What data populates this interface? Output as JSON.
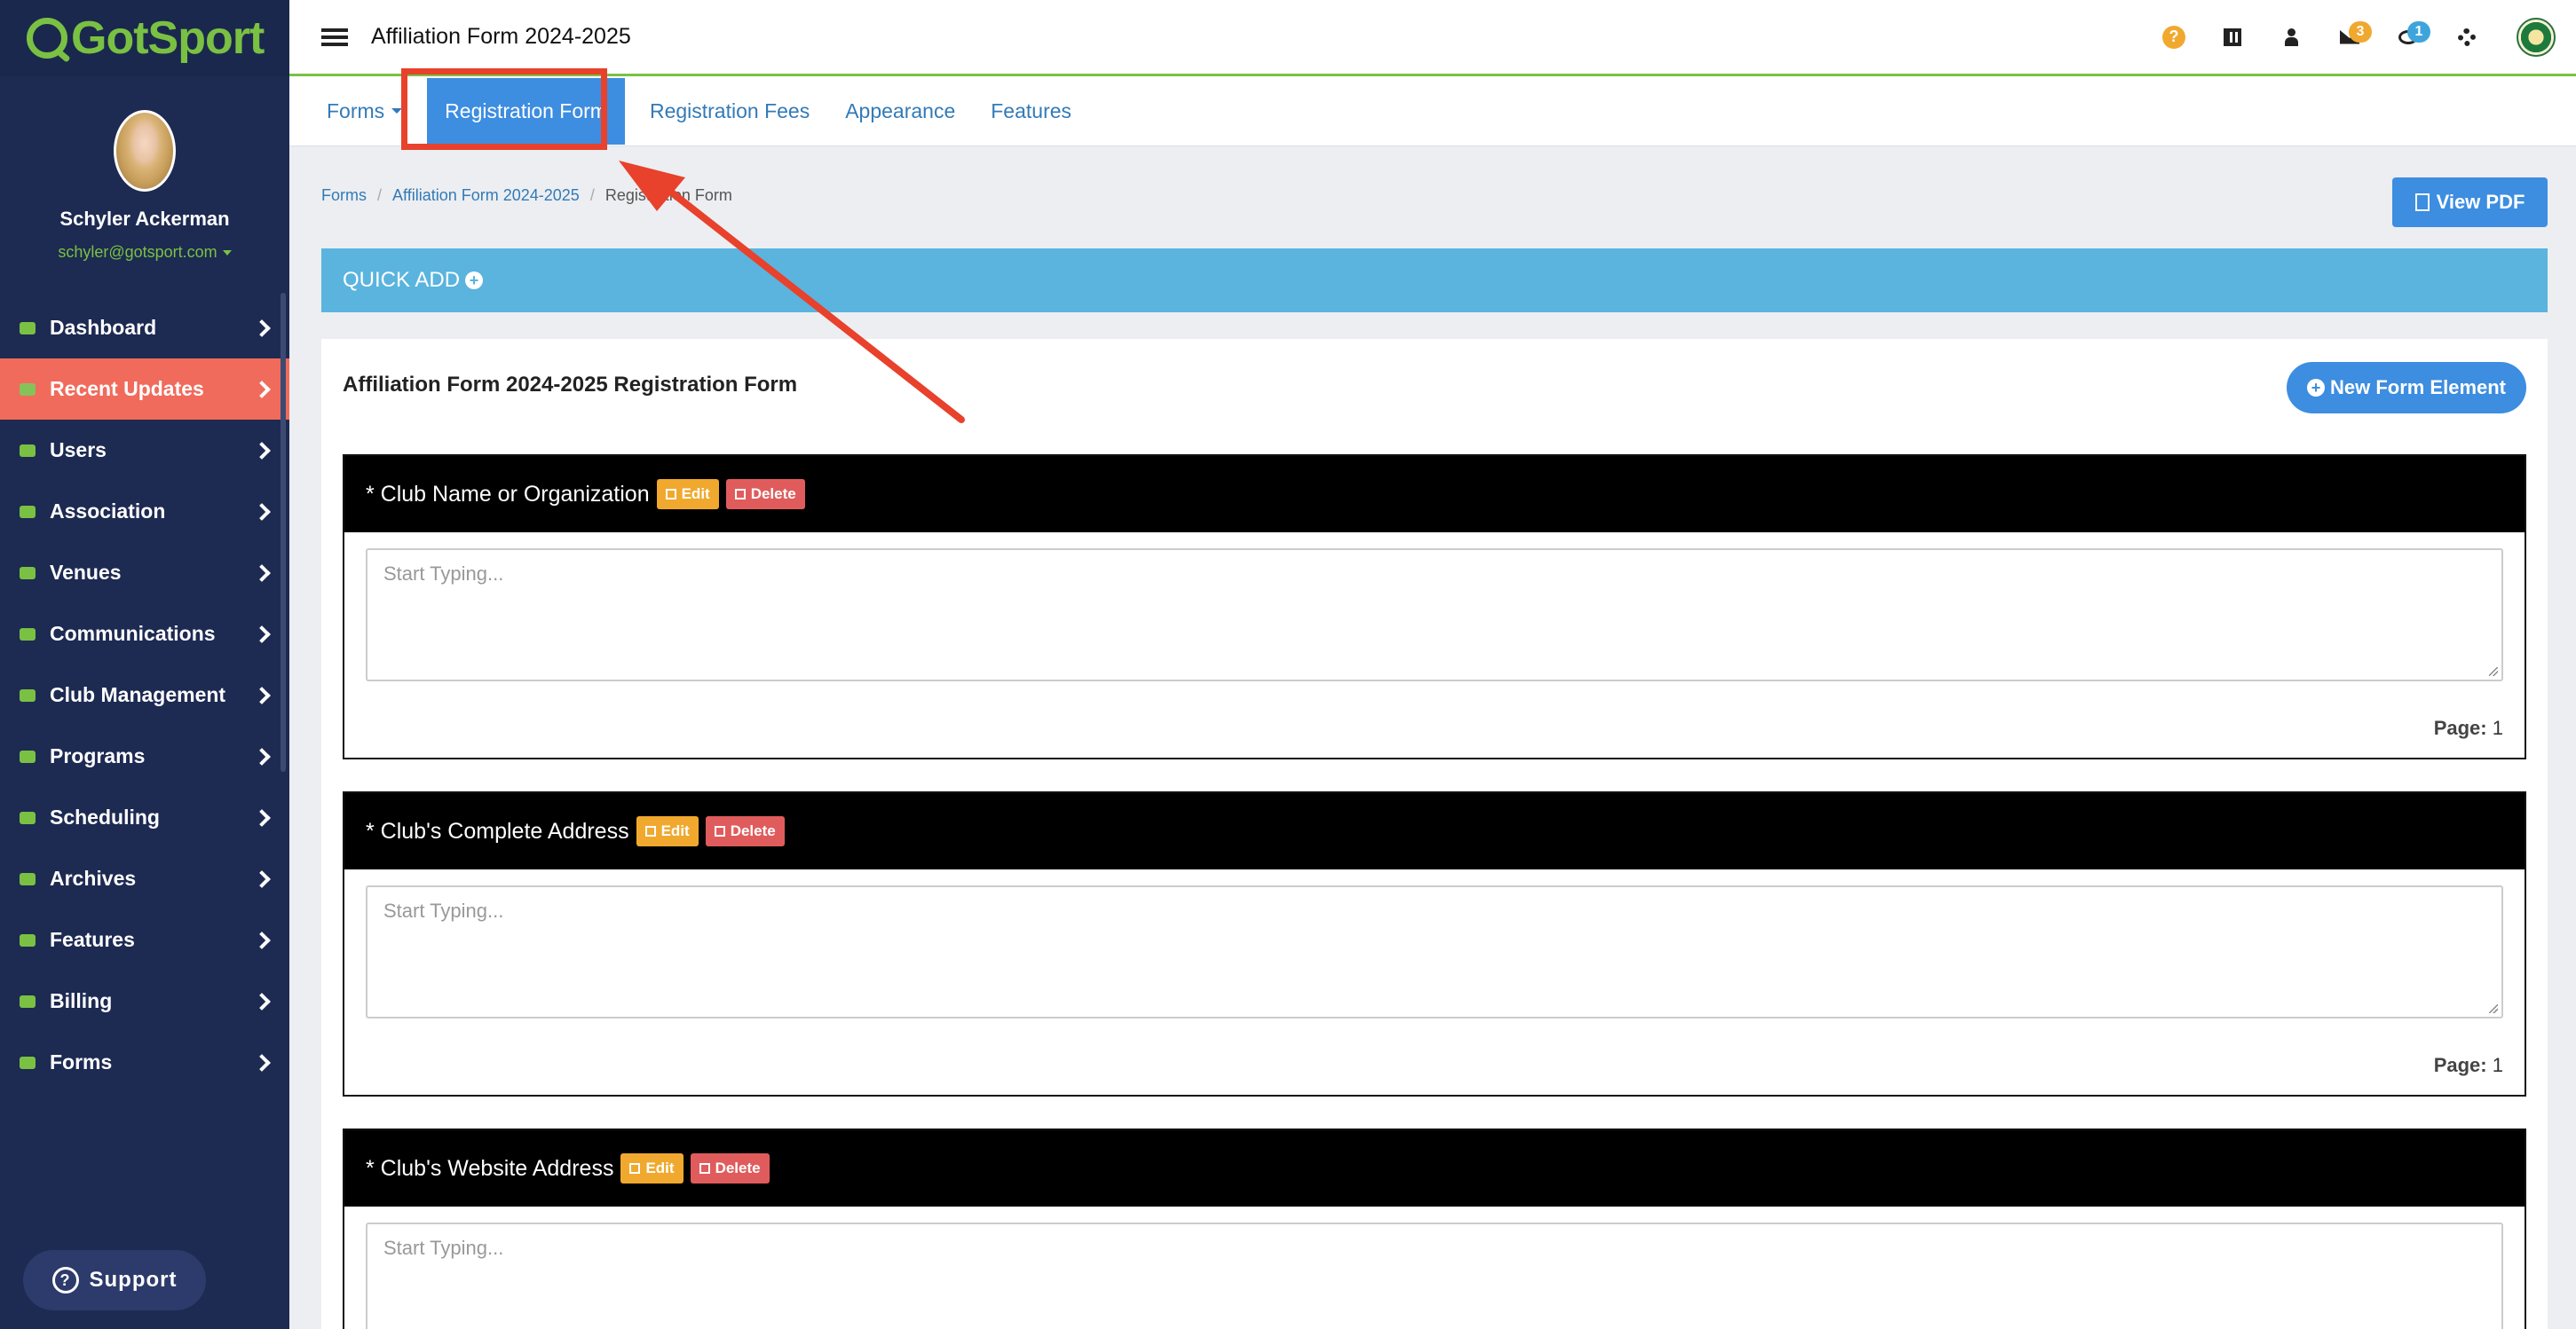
{
  "brand": {
    "name": "GotSport"
  },
  "profile": {
    "name": "Schyler Ackerman",
    "email": "schyler@gotsport.com"
  },
  "sidebar": {
    "items": [
      {
        "label": "Dashboard",
        "icon": "dashboard-icon"
      },
      {
        "label": "Recent Updates",
        "icon": "calendar-icon",
        "active": true
      },
      {
        "label": "Users",
        "icon": "users-icon"
      },
      {
        "label": "Association",
        "icon": "sitemap-icon"
      },
      {
        "label": "Venues",
        "icon": "home-icon"
      },
      {
        "label": "Communications",
        "icon": "chat-icon"
      },
      {
        "label": "Club Management",
        "icon": "list-icon"
      },
      {
        "label": "Programs",
        "icon": "document-icon"
      },
      {
        "label": "Scheduling",
        "icon": "table-icon"
      },
      {
        "label": "Archives",
        "icon": "archive-icon"
      },
      {
        "label": "Features",
        "icon": "star-icon"
      },
      {
        "label": "Billing",
        "icon": "credit-card-icon"
      },
      {
        "label": "Forms",
        "icon": "file-icon"
      }
    ],
    "support_label": "Support"
  },
  "topbar": {
    "title": "Affiliation Form 2024-2025",
    "mail_count": "3",
    "chat_count": "1"
  },
  "tabs": {
    "forms": "Forms",
    "registration_form": "Registration Form",
    "registration_fees": "Registration Fees",
    "appearance": "Appearance",
    "features": "Features"
  },
  "breadcrumb": {
    "item1": "Forms",
    "item2": "Affiliation Form 2024-2025",
    "item3": "Registration Form"
  },
  "buttons": {
    "view_pdf": "View PDF",
    "quick_add": "QUICK ADD",
    "new_form_element": "New Form Element",
    "edit": "Edit",
    "delete": "Delete"
  },
  "form": {
    "title": "Affiliation Form 2024-2025 Registration Form",
    "fields": [
      {
        "label": "* Club Name or Organization",
        "placeholder": "Start Typing...",
        "page_label": "Page:",
        "page": "1"
      },
      {
        "label": "* Club's Complete Address",
        "placeholder": "Start Typing...",
        "page_label": "Page:",
        "page": "1"
      },
      {
        "label": "* Club's Website Address",
        "placeholder": "Start Typing..."
      }
    ]
  },
  "colors": {
    "sidebar_bg": "#1d2a52",
    "brand_green": "#7ac143",
    "active_nav": "#f06b5c",
    "primary_blue": "#3d8de0",
    "quick_add_bg": "#5ab4de",
    "annotation_red": "#e8412c"
  }
}
